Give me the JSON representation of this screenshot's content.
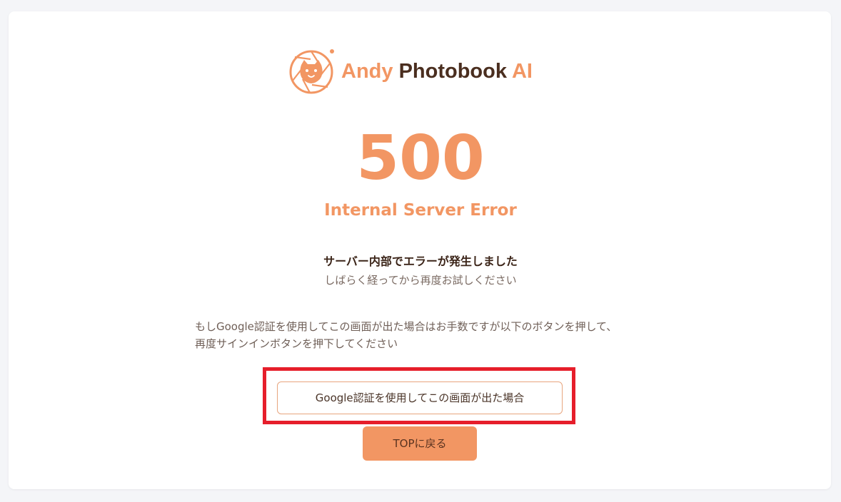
{
  "brand": {
    "name_part1": "Andy",
    "name_part2": "Photobook",
    "name_part3": "AI",
    "logo_icon": "camera-aperture-dog-icon",
    "accent_color": "#f29663",
    "dark_color": "#4a2e1f"
  },
  "error": {
    "code": "500",
    "title": "Internal Server Error"
  },
  "message": {
    "main": "サーバー内部でエラーが発生しました",
    "sub": "しばらく経ってから再度お試しください"
  },
  "notice": {
    "line1": "もしGoogle認証を使用してこの画面が出た場合はお手数ですが以下のボタンを押して、",
    "line2": "再度サインインボタンを押下してください"
  },
  "buttons": {
    "google_label": "Google認証を使用してこの画面が出た場合",
    "top_label": "TOPに戻る"
  },
  "highlight_color": "#e61e2b"
}
